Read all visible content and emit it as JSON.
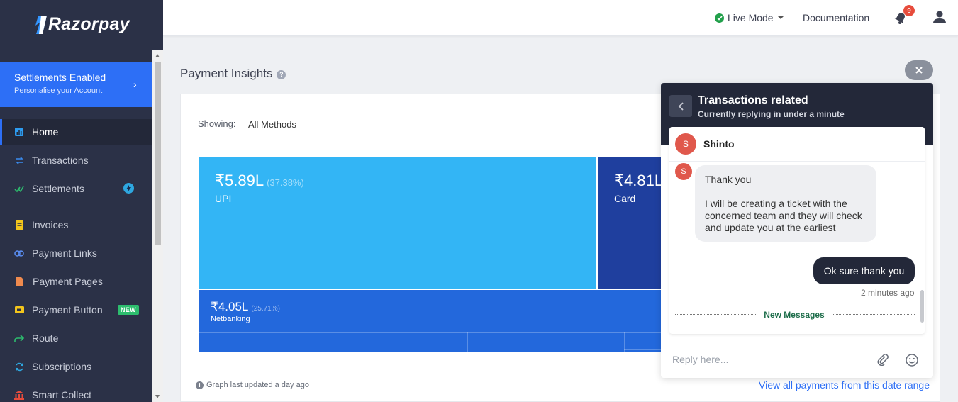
{
  "brand": {
    "name": "Razorpay"
  },
  "sidebar": {
    "banner": {
      "title": "Settlements Enabled",
      "subtitle": "Personalise your Account"
    },
    "items": [
      {
        "label": "Home",
        "icon": "chart-icon",
        "active": true
      },
      {
        "label": "Transactions",
        "icon": "transfer-icon"
      },
      {
        "label": "Settlements",
        "icon": "check-icon"
      },
      {
        "label": "Invoices",
        "icon": "invoice-icon"
      },
      {
        "label": "Payment Links",
        "icon": "link-icon"
      },
      {
        "label": "Payment Pages",
        "icon": "page-icon"
      },
      {
        "label": "Payment Button",
        "icon": "button-icon",
        "badge": "NEW"
      },
      {
        "label": "Route",
        "icon": "route-icon"
      },
      {
        "label": "Subscriptions",
        "icon": "refresh-icon"
      },
      {
        "label": "Smart Collect",
        "icon": "bank-icon"
      }
    ]
  },
  "header": {
    "mode": "Live Mode",
    "docs": "Documentation",
    "notification_count": "9"
  },
  "main": {
    "title": "Payment Insights",
    "showing_label": "Showing:",
    "showing_value": "All Methods",
    "tiles": [
      {
        "amount": "₹5.89L",
        "percent": "(37.38%)",
        "name": "UPI",
        "color": "#33b5f5"
      },
      {
        "amount": "₹4.81L",
        "name": "Card",
        "color": "#1f3f9e"
      },
      {
        "amount": "₹4.05L",
        "percent": "(25.71%)",
        "name": "Netbanking",
        "color": "#2368dc"
      }
    ],
    "footer_note": "Graph last updated a day ago",
    "view_all": "View all payments from this date range"
  },
  "chat": {
    "title": "Transactions related",
    "subtitle": "Currently replying in under a minute",
    "agent": {
      "name": "Shinto",
      "initial": "S"
    },
    "agent_message": [
      "Thank you",
      "I will be creating a ticket with the",
      "concerned team and they will check",
      "and update you at the earliest"
    ],
    "user_message": "Ok sure thank you",
    "user_time": "2 minutes ago",
    "new_messages": "New Messages",
    "input_placeholder": "Reply here..."
  }
}
